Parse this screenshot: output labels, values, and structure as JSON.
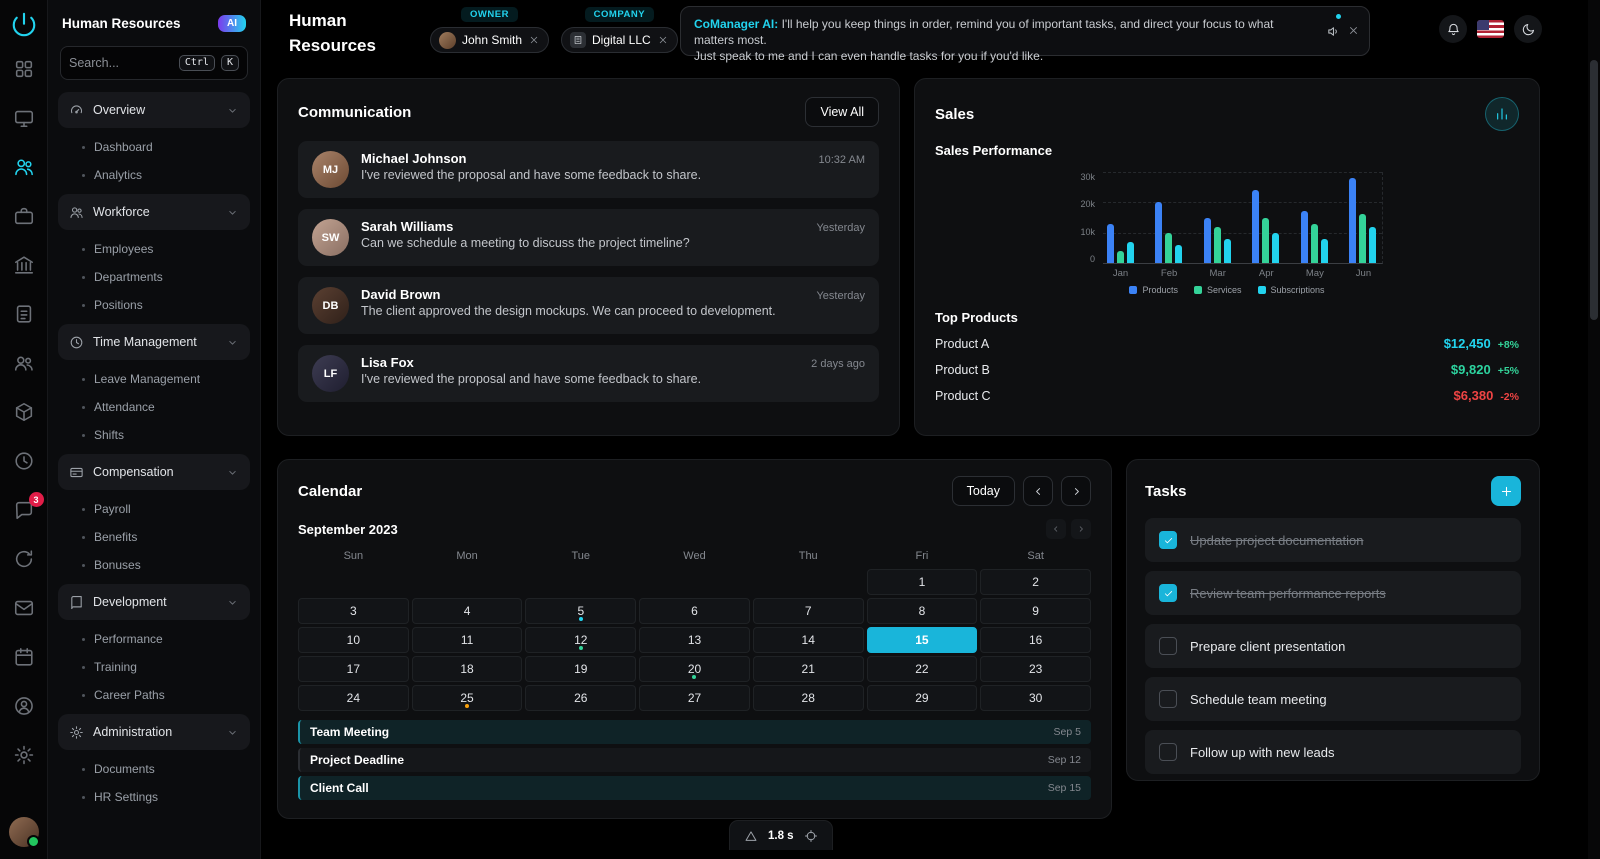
{
  "app": {
    "name": "Human Resources",
    "ai_badge": "AI",
    "search_placeholder": "Search...",
    "kbd_ctrl": "Ctrl",
    "kbd_k": "K"
  },
  "rail": {
    "items": [
      {
        "icon": "apps"
      },
      {
        "icon": "monitor"
      },
      {
        "icon": "people",
        "active": true
      },
      {
        "icon": "briefcase"
      },
      {
        "icon": "bank"
      },
      {
        "icon": "clipboard"
      },
      {
        "icon": "users"
      },
      {
        "icon": "package"
      },
      {
        "icon": "clock"
      },
      {
        "icon": "chat",
        "badge": "3"
      },
      {
        "icon": "refresh"
      },
      {
        "icon": "mail"
      },
      {
        "icon": "calendar"
      },
      {
        "icon": "contact"
      },
      {
        "icon": "gear"
      }
    ]
  },
  "sidebar": {
    "sections": [
      {
        "label": "Overview",
        "icon": "gauge",
        "children": [
          "Dashboard",
          "Analytics"
        ]
      },
      {
        "label": "Workforce",
        "icon": "people",
        "children": [
          "Employees",
          "Departments",
          "Positions"
        ]
      },
      {
        "label": "Time Management",
        "icon": "clock",
        "children": [
          "Leave Management",
          "Attendance",
          "Shifts"
        ]
      },
      {
        "label": "Compensation",
        "icon": "card",
        "children": [
          "Payroll",
          "Benefits",
          "Bonuses"
        ]
      },
      {
        "label": "Development",
        "icon": "book",
        "children": [
          "Performance",
          "Training",
          "Career Paths"
        ]
      },
      {
        "label": "Administration",
        "icon": "gear",
        "children": [
          "Documents",
          "HR Settings"
        ]
      }
    ]
  },
  "header": {
    "title": "Human Resources",
    "owner_label": "OWNER",
    "owner_name": "John Smith",
    "company_label": "COMPANY",
    "company_name": "Digital LLC",
    "ai_name": "CoManager AI:",
    "ai_message_1": "I'll help you keep things in order, remind you of important tasks, and direct your focus to what matters most.",
    "ai_message_2": "Just speak to me and I can even handle tasks for you if you'd like."
  },
  "communication": {
    "title": "Communication",
    "view_all": "View All",
    "messages": [
      {
        "name": "Michael Johnson",
        "time": "10:32 AM",
        "text": "I've reviewed the proposal and have some feedback to share."
      },
      {
        "name": "Sarah Williams",
        "time": "Yesterday",
        "text": "Can we schedule a meeting to discuss the project timeline?"
      },
      {
        "name": "David Brown",
        "time": "Yesterday",
        "text": "The client approved the design mockups. We can proceed to development."
      },
      {
        "name": "Lisa Fox",
        "time": "2 days ago",
        "text": "I've reviewed the proposal and have some feedback to share."
      }
    ]
  },
  "sales": {
    "title": "Sales",
    "subtitle": "Sales Performance",
    "top_products_label": "Top Products",
    "products": [
      {
        "name": "Product A",
        "value": "$12,450",
        "change": "+8%",
        "value_color": "#22d3ee"
      },
      {
        "name": "Product B",
        "value": "$9,820",
        "change": "+5%",
        "value_color": "#2dd4a0"
      },
      {
        "name": "Product C",
        "value": "$6,380",
        "change": "-2%",
        "value_color": "#ef4444"
      }
    ],
    "up_color": "#34d399",
    "down_color": "#ef4444"
  },
  "chart_data": {
    "type": "bar",
    "title": "Sales Performance",
    "categories": [
      "Jan",
      "Feb",
      "Mar",
      "Apr",
      "May",
      "Jun"
    ],
    "series": [
      {
        "name": "Products",
        "color": "#3b82f6",
        "values": [
          13000,
          20000,
          15000,
          24000,
          17000,
          28000
        ]
      },
      {
        "name": "Services",
        "color": "#34d399",
        "values": [
          4000,
          10000,
          12000,
          15000,
          13000,
          16000
        ]
      },
      {
        "name": "Subscriptions",
        "color": "#22d3ee",
        "values": [
          7000,
          6000,
          8000,
          10000,
          8000,
          12000
        ]
      }
    ],
    "ylim": [
      0,
      30000
    ],
    "yticks": [
      "30k",
      "20k",
      "10k",
      "0"
    ],
    "grid": "dashed-horizontal",
    "legend_position": "bottom"
  },
  "calendar": {
    "title": "Calendar",
    "today_label": "Today",
    "month": "September 2023",
    "day_headers": [
      "Sun",
      "Mon",
      "Tue",
      "Wed",
      "Thu",
      "Fri",
      "Sat"
    ],
    "first_weekday": 5,
    "days_in_month": 30,
    "selected_day": 15,
    "dots": {
      "5": "#22d3ee",
      "12": "#34d399",
      "20": "#34d399",
      "25": "#f59e0b"
    },
    "events": [
      {
        "name": "Team Meeting",
        "date": "Sep 5",
        "highlight": true
      },
      {
        "name": "Project Deadline",
        "date": "Sep 12",
        "highlight": false
      },
      {
        "name": "Client Call",
        "date": "Sep 15",
        "highlight": true
      }
    ]
  },
  "tasks": {
    "title": "Tasks",
    "items": [
      {
        "text": "Update project documentation",
        "done": true
      },
      {
        "text": "Review team performance reports",
        "done": true
      },
      {
        "text": "Prepare client presentation",
        "done": false
      },
      {
        "text": "Schedule team meeting",
        "done": false
      },
      {
        "text": "Follow up with new leads",
        "done": false
      }
    ]
  },
  "statusbar": {
    "time": "1.8 s"
  }
}
